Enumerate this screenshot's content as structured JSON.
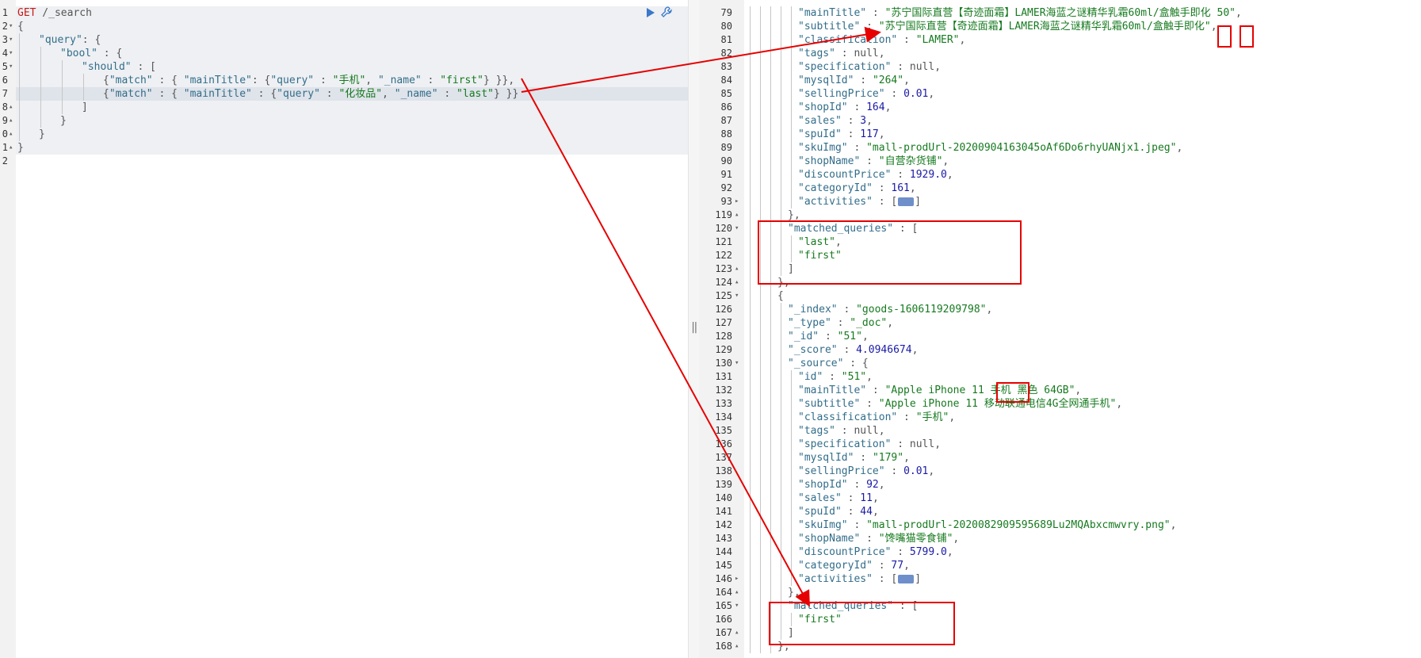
{
  "request": {
    "method": "GET",
    "path": " /_search",
    "lines": [
      {
        "n": "1",
        "fold": "",
        "indent": 0,
        "tokens": [
          [
            "m",
            "GET"
          ],
          [
            "p",
            " /_search"
          ]
        ]
      },
      {
        "n": "2",
        "fold": "▾",
        "indent": 0,
        "tokens": [
          [
            "p",
            "{"
          ]
        ]
      },
      {
        "n": "3",
        "fold": "▾",
        "indent": 1,
        "tokens": [
          [
            "k",
            "\"query\""
          ],
          [
            "p",
            ": {"
          ]
        ]
      },
      {
        "n": "4",
        "fold": "▾",
        "indent": 2,
        "tokens": [
          [
            "k",
            "\"bool\""
          ],
          [
            "p",
            " : {"
          ]
        ]
      },
      {
        "n": "5",
        "fold": "▾",
        "indent": 3,
        "tokens": [
          [
            "k",
            "\"should\""
          ],
          [
            "p",
            " : ["
          ]
        ]
      },
      {
        "n": "6",
        "fold": "",
        "indent": 4,
        "tokens": [
          [
            "p",
            "{"
          ],
          [
            "k",
            "\"match\""
          ],
          [
            "p",
            " : { "
          ],
          [
            "k",
            "\"mainTitle\""
          ],
          [
            "p",
            ": {"
          ],
          [
            "k",
            "\"query\""
          ],
          [
            "p",
            " : "
          ],
          [
            "s",
            "\"手机\""
          ],
          [
            "p",
            ", "
          ],
          [
            "k",
            "\"_name\""
          ],
          [
            "p",
            " : "
          ],
          [
            "s",
            "\"first\""
          ],
          [
            "p",
            "} }},"
          ]
        ]
      },
      {
        "n": "7",
        "fold": "",
        "indent": 4,
        "tokens": [
          [
            "p",
            "{"
          ],
          [
            "k",
            "\"match\""
          ],
          [
            "p",
            " : { "
          ],
          [
            "k",
            "\"mainTitle\""
          ],
          [
            "p",
            " : {"
          ],
          [
            "k",
            "\"query\""
          ],
          [
            "p",
            " : "
          ],
          [
            "s",
            "\"化妆品\""
          ],
          [
            "p",
            ", "
          ],
          [
            "k",
            "\"_name\""
          ],
          [
            "p",
            " : "
          ],
          [
            "s",
            "\"last\""
          ],
          [
            "p",
            "} }}"
          ]
        ]
      },
      {
        "n": "8",
        "fold": "▴",
        "indent": 3,
        "tokens": [
          [
            "p",
            "]"
          ]
        ]
      },
      {
        "n": "9",
        "fold": "▴",
        "indent": 2,
        "tokens": [
          [
            "p",
            "}"
          ]
        ]
      },
      {
        "n": "0",
        "fold": "▴",
        "indent": 1,
        "tokens": [
          [
            "p",
            "}"
          ]
        ]
      },
      {
        "n": "1",
        "fold": "▴",
        "indent": 0,
        "tokens": [
          [
            "p",
            "}"
          ]
        ]
      },
      {
        "n": "2",
        "fold": "",
        "indent": 0,
        "tokens": []
      }
    ]
  },
  "response": {
    "lines": [
      {
        "n": "79",
        "fold": "",
        "indent": 5,
        "tokens": [
          [
            "k",
            "\"mainTitle\""
          ],
          [
            "p",
            " : "
          ],
          [
            "s",
            "\"苏宁国际直营【奇迹面霜】LAMER海蓝之谜精华乳霜60ml/盒触手即化 50\""
          ],
          [
            "p",
            ","
          ]
        ]
      },
      {
        "n": "80",
        "fold": "",
        "indent": 5,
        "tokens": [
          [
            "k",
            "\"subtitle\""
          ],
          [
            "p",
            " : "
          ],
          [
            "s",
            "\"苏宁国际直营【奇迹面霜】LAMER海蓝之谜精华乳霜60ml/盒触手即化\""
          ],
          [
            "p",
            ","
          ]
        ]
      },
      {
        "n": "81",
        "fold": "",
        "indent": 5,
        "tokens": [
          [
            "k",
            "\"classification\""
          ],
          [
            "p",
            " : "
          ],
          [
            "s",
            "\"LAMER\""
          ],
          [
            "p",
            ","
          ]
        ]
      },
      {
        "n": "82",
        "fold": "",
        "indent": 5,
        "tokens": [
          [
            "k",
            "\"tags\""
          ],
          [
            "p",
            " : null,"
          ]
        ]
      },
      {
        "n": "83",
        "fold": "",
        "indent": 5,
        "tokens": [
          [
            "k",
            "\"specification\""
          ],
          [
            "p",
            " : null,"
          ]
        ]
      },
      {
        "n": "84",
        "fold": "",
        "indent": 5,
        "tokens": [
          [
            "k",
            "\"mysqlId\""
          ],
          [
            "p",
            " : "
          ],
          [
            "s",
            "\"264\""
          ],
          [
            "p",
            ","
          ]
        ]
      },
      {
        "n": "85",
        "fold": "",
        "indent": 5,
        "tokens": [
          [
            "k",
            "\"sellingPrice\""
          ],
          [
            "p",
            " : "
          ],
          [
            "n",
            "0.01"
          ],
          [
            "p",
            ","
          ]
        ]
      },
      {
        "n": "86",
        "fold": "",
        "indent": 5,
        "tokens": [
          [
            "k",
            "\"shopId\""
          ],
          [
            "p",
            " : "
          ],
          [
            "n",
            "164"
          ],
          [
            "p",
            ","
          ]
        ]
      },
      {
        "n": "87",
        "fold": "",
        "indent": 5,
        "tokens": [
          [
            "k",
            "\"sales\""
          ],
          [
            "p",
            " : "
          ],
          [
            "n",
            "3"
          ],
          [
            "p",
            ","
          ]
        ]
      },
      {
        "n": "88",
        "fold": "",
        "indent": 5,
        "tokens": [
          [
            "k",
            "\"spuId\""
          ],
          [
            "p",
            " : "
          ],
          [
            "n",
            "117"
          ],
          [
            "p",
            ","
          ]
        ]
      },
      {
        "n": "89",
        "fold": "",
        "indent": 5,
        "tokens": [
          [
            "k",
            "\"skuImg\""
          ],
          [
            "p",
            " : "
          ],
          [
            "s",
            "\"mall-prodUrl-20200904163045oAf6Do6rhyUANjx1.jpeg\""
          ],
          [
            "p",
            ","
          ]
        ]
      },
      {
        "n": "90",
        "fold": "",
        "indent": 5,
        "tokens": [
          [
            "k",
            "\"shopName\""
          ],
          [
            "p",
            " : "
          ],
          [
            "s",
            "\"自营杂货铺\""
          ],
          [
            "p",
            ","
          ]
        ]
      },
      {
        "n": "91",
        "fold": "",
        "indent": 5,
        "tokens": [
          [
            "k",
            "\"discountPrice\""
          ],
          [
            "p",
            " : "
          ],
          [
            "n",
            "1929.0"
          ],
          [
            "p",
            ","
          ]
        ]
      },
      {
        "n": "92",
        "fold": "",
        "indent": 5,
        "tokens": [
          [
            "k",
            "\"categoryId\""
          ],
          [
            "p",
            " : "
          ],
          [
            "n",
            "161"
          ],
          [
            "p",
            ","
          ]
        ]
      },
      {
        "n": "93",
        "fold": "▸",
        "indent": 5,
        "tokens": [
          [
            "k",
            "\"activities\""
          ],
          [
            "p",
            " : ["
          ],
          [
            "badge",
            ""
          ],
          [
            "p",
            "]"
          ]
        ]
      },
      {
        "n": "119",
        "fold": "▴",
        "indent": 4,
        "tokens": [
          [
            "p",
            "},"
          ]
        ]
      },
      {
        "n": "120",
        "fold": "▾",
        "indent": 4,
        "tokens": [
          [
            "k",
            "\"matched_queries\""
          ],
          [
            "p",
            " : ["
          ]
        ]
      },
      {
        "n": "121",
        "fold": "",
        "indent": 5,
        "tokens": [
          [
            "s",
            "\"last\""
          ],
          [
            "p",
            ","
          ]
        ]
      },
      {
        "n": "122",
        "fold": "",
        "indent": 5,
        "tokens": [
          [
            "s",
            "\"first\""
          ]
        ]
      },
      {
        "n": "123",
        "fold": "▴",
        "indent": 4,
        "tokens": [
          [
            "p",
            "]"
          ]
        ]
      },
      {
        "n": "124",
        "fold": "▴",
        "indent": 3,
        "tokens": [
          [
            "p",
            "},"
          ]
        ]
      },
      {
        "n": "125",
        "fold": "▾",
        "indent": 3,
        "tokens": [
          [
            "p",
            "{"
          ]
        ]
      },
      {
        "n": "126",
        "fold": "",
        "indent": 4,
        "tokens": [
          [
            "k",
            "\"_index\""
          ],
          [
            "p",
            " : "
          ],
          [
            "s",
            "\"goods-1606119209798\""
          ],
          [
            "p",
            ","
          ]
        ]
      },
      {
        "n": "127",
        "fold": "",
        "indent": 4,
        "tokens": [
          [
            "k",
            "\"_type\""
          ],
          [
            "p",
            " : "
          ],
          [
            "s",
            "\"_doc\""
          ],
          [
            "p",
            ","
          ]
        ]
      },
      {
        "n": "128",
        "fold": "",
        "indent": 4,
        "tokens": [
          [
            "k",
            "\"_id\""
          ],
          [
            "p",
            " : "
          ],
          [
            "s",
            "\"51\""
          ],
          [
            "p",
            ","
          ]
        ]
      },
      {
        "n": "129",
        "fold": "",
        "indent": 4,
        "tokens": [
          [
            "k",
            "\"_score\""
          ],
          [
            "p",
            " : "
          ],
          [
            "n",
            "4.0946674"
          ],
          [
            "p",
            ","
          ]
        ]
      },
      {
        "n": "130",
        "fold": "▾",
        "indent": 4,
        "tokens": [
          [
            "k",
            "\"_source\""
          ],
          [
            "p",
            " : {"
          ]
        ]
      },
      {
        "n": "131",
        "fold": "",
        "indent": 5,
        "tokens": [
          [
            "k",
            "\"id\""
          ],
          [
            "p",
            " : "
          ],
          [
            "s",
            "\"51\""
          ],
          [
            "p",
            ","
          ]
        ]
      },
      {
        "n": "132",
        "fold": "",
        "indent": 5,
        "tokens": [
          [
            "k",
            "\"mainTitle\""
          ],
          [
            "p",
            " : "
          ],
          [
            "s",
            "\"Apple iPhone 11 手机 黑色 64GB\""
          ],
          [
            "p",
            ","
          ]
        ]
      },
      {
        "n": "133",
        "fold": "",
        "indent": 5,
        "tokens": [
          [
            "k",
            "\"subtitle\""
          ],
          [
            "p",
            " : "
          ],
          [
            "s",
            "\"Apple iPhone 11 移动联通电信4G全网通手机\""
          ],
          [
            "p",
            ","
          ]
        ]
      },
      {
        "n": "134",
        "fold": "",
        "indent": 5,
        "tokens": [
          [
            "k",
            "\"classification\""
          ],
          [
            "p",
            " : "
          ],
          [
            "s",
            "\"手机\""
          ],
          [
            "p",
            ","
          ]
        ]
      },
      {
        "n": "135",
        "fold": "",
        "indent": 5,
        "tokens": [
          [
            "k",
            "\"tags\""
          ],
          [
            "p",
            " : null,"
          ]
        ]
      },
      {
        "n": "136",
        "fold": "",
        "indent": 5,
        "tokens": [
          [
            "k",
            "\"specification\""
          ],
          [
            "p",
            " : null,"
          ]
        ]
      },
      {
        "n": "137",
        "fold": "",
        "indent": 5,
        "tokens": [
          [
            "k",
            "\"mysqlId\""
          ],
          [
            "p",
            " : "
          ],
          [
            "s",
            "\"179\""
          ],
          [
            "p",
            ","
          ]
        ]
      },
      {
        "n": "138",
        "fold": "",
        "indent": 5,
        "tokens": [
          [
            "k",
            "\"sellingPrice\""
          ],
          [
            "p",
            " : "
          ],
          [
            "n",
            "0.01"
          ],
          [
            "p",
            ","
          ]
        ]
      },
      {
        "n": "139",
        "fold": "",
        "indent": 5,
        "tokens": [
          [
            "k",
            "\"shopId\""
          ],
          [
            "p",
            " : "
          ],
          [
            "n",
            "92"
          ],
          [
            "p",
            ","
          ]
        ]
      },
      {
        "n": "140",
        "fold": "",
        "indent": 5,
        "tokens": [
          [
            "k",
            "\"sales\""
          ],
          [
            "p",
            " : "
          ],
          [
            "n",
            "11"
          ],
          [
            "p",
            ","
          ]
        ]
      },
      {
        "n": "141",
        "fold": "",
        "indent": 5,
        "tokens": [
          [
            "k",
            "\"spuId\""
          ],
          [
            "p",
            " : "
          ],
          [
            "n",
            "44"
          ],
          [
            "p",
            ","
          ]
        ]
      },
      {
        "n": "142",
        "fold": "",
        "indent": 5,
        "tokens": [
          [
            "k",
            "\"skuImg\""
          ],
          [
            "p",
            " : "
          ],
          [
            "s",
            "\"mall-prodUrl-2020082909595689Lu2MQAbxcmwvry.png\""
          ],
          [
            "p",
            ","
          ]
        ]
      },
      {
        "n": "143",
        "fold": "",
        "indent": 5,
        "tokens": [
          [
            "k",
            "\"shopName\""
          ],
          [
            "p",
            " : "
          ],
          [
            "s",
            "\"馋嘴猫零食铺\""
          ],
          [
            "p",
            ","
          ]
        ]
      },
      {
        "n": "144",
        "fold": "",
        "indent": 5,
        "tokens": [
          [
            "k",
            "\"discountPrice\""
          ],
          [
            "p",
            " : "
          ],
          [
            "n",
            "5799.0"
          ],
          [
            "p",
            ","
          ]
        ]
      },
      {
        "n": "145",
        "fold": "",
        "indent": 5,
        "tokens": [
          [
            "k",
            "\"categoryId\""
          ],
          [
            "p",
            " : "
          ],
          [
            "n",
            "77"
          ],
          [
            "p",
            ","
          ]
        ]
      },
      {
        "n": "146",
        "fold": "▸",
        "indent": 5,
        "tokens": [
          [
            "k",
            "\"activities\""
          ],
          [
            "p",
            " : ["
          ],
          [
            "badge",
            ""
          ],
          [
            "p",
            "]"
          ]
        ]
      },
      {
        "n": "164",
        "fold": "▴",
        "indent": 4,
        "tokens": [
          [
            "p",
            "},"
          ]
        ]
      },
      {
        "n": "165",
        "fold": "▾",
        "indent": 4,
        "tokens": [
          [
            "k",
            "\"matched_queries\""
          ],
          [
            "p",
            " : ["
          ]
        ]
      },
      {
        "n": "166",
        "fold": "",
        "indent": 5,
        "tokens": [
          [
            "s",
            "\"first\""
          ]
        ]
      },
      {
        "n": "167",
        "fold": "▴",
        "indent": 4,
        "tokens": [
          [
            "p",
            "]"
          ]
        ]
      },
      {
        "n": "168",
        "fold": "▴",
        "indent": 3,
        "tokens": [
          [
            "p",
            "},"
          ]
        ]
      }
    ]
  },
  "icons": {
    "run": "run-icon",
    "settings": "wrench-icon"
  },
  "colors": {
    "annotation": "#e60000",
    "key": "#326d8a",
    "string": "#167a1f",
    "number": "#1a1aa6",
    "method": "#c41a16"
  }
}
